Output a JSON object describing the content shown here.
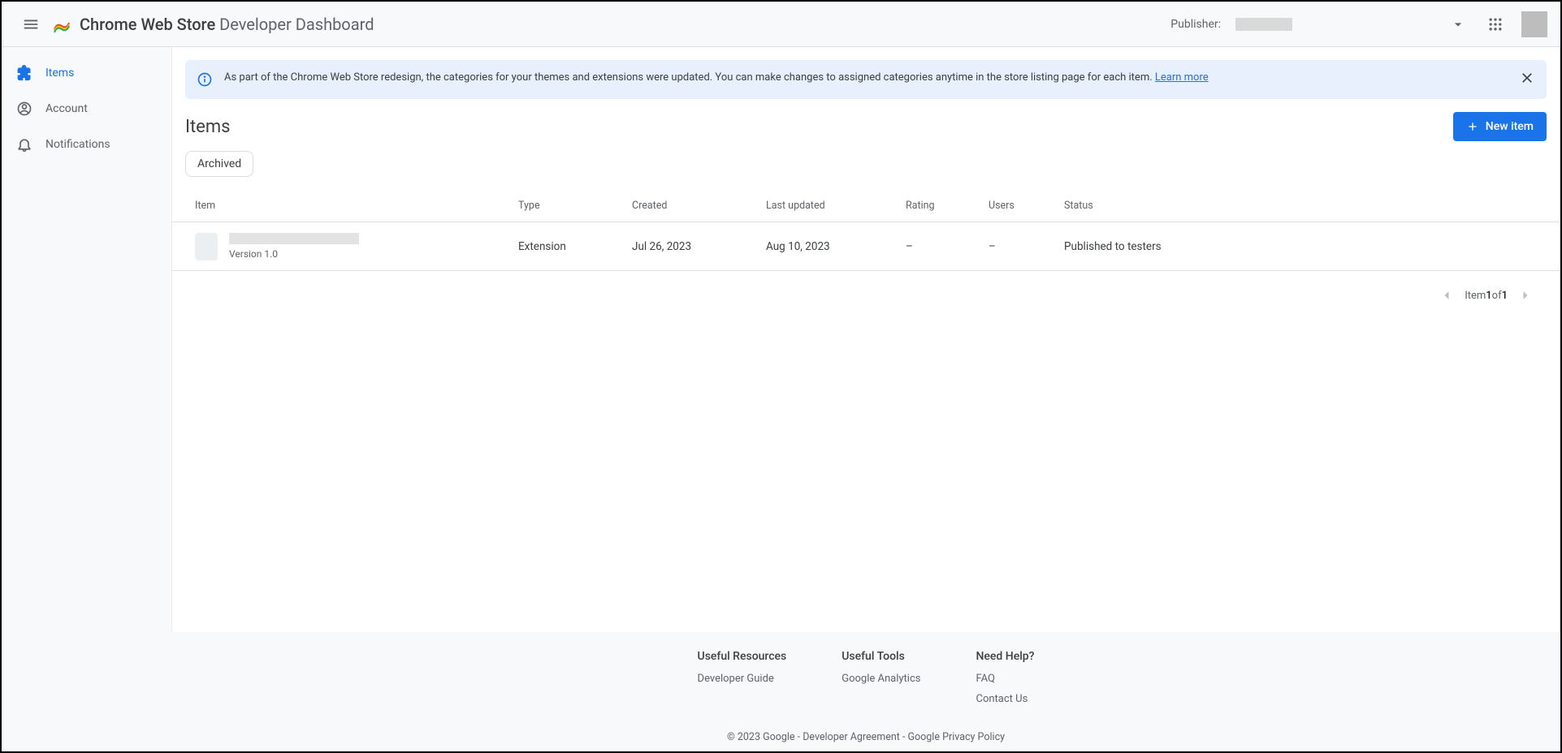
{
  "header": {
    "brand_bold": "Chrome Web Store",
    "brand_light": "Developer Dashboard",
    "publisher_label": "Publisher:"
  },
  "sidebar": {
    "items": "Items",
    "account": "Account",
    "notifications": "Notifications"
  },
  "banner": {
    "text": "As part of the Chrome Web Store redesign, the categories for your themes and extensions were updated. You can make changes to assigned categories anytime in the store listing page for each item. ",
    "learn_more": "Learn more"
  },
  "page": {
    "title": "Items",
    "new_item": "New item",
    "archived_chip": "Archived"
  },
  "table": {
    "headers": {
      "item": "Item",
      "type": "Type",
      "created": "Created",
      "updated": "Last updated",
      "rating": "Rating",
      "users": "Users",
      "status": "Status"
    },
    "row": {
      "version": "Version 1.0",
      "type": "Extension",
      "created": "Jul 26, 2023",
      "updated": "Aug 10, 2023",
      "rating": "–",
      "users": "–",
      "status": "Published to testers"
    }
  },
  "pager": {
    "prefix": "Item ",
    "current": "1",
    "of": " of ",
    "total": "1"
  },
  "footer": {
    "col1_title": "Useful Resources",
    "col1_link1": "Developer Guide",
    "col2_title": "Useful Tools",
    "col2_link1": "Google Analytics",
    "col3_title": "Need Help?",
    "col3_link1": "FAQ",
    "col3_link2": "Contact Us",
    "copy_year": "© 2023 Google",
    "copy_sep": " - ",
    "copy_dev": "Developer Agreement",
    "copy_priv": "Google Privacy Policy"
  }
}
